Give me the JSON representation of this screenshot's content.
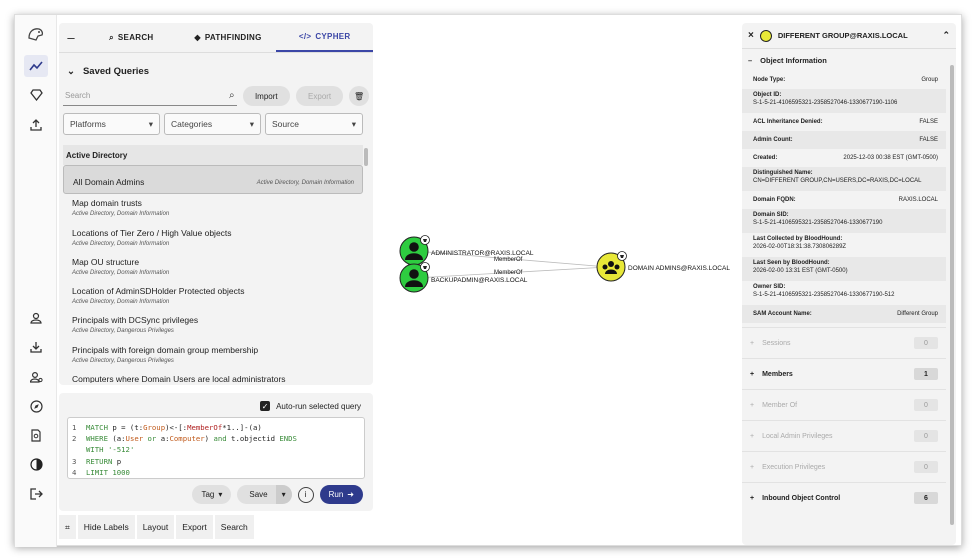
{
  "tabs": {
    "search": "SEARCH",
    "pathfinding": "PATHFINDING",
    "cypher": "CYPHER"
  },
  "saved_queries": {
    "title": "Saved Queries",
    "search_placeholder": "Search",
    "import_label": "Import",
    "export_label": "Export",
    "filters": [
      "Platforms",
      "Categories",
      "Source"
    ],
    "category": "Active Directory",
    "items": [
      {
        "title": "All Domain Admins",
        "sub": "Active Directory, Domain Information"
      },
      {
        "title": "Map domain trusts",
        "sub": "Active Directory, Domain Information"
      },
      {
        "title": "Locations of Tier Zero / High Value objects",
        "sub": "Active Directory, Domain Information"
      },
      {
        "title": "Map OU structure",
        "sub": "Active Directory, Domain Information"
      },
      {
        "title": "Location of AdminSDHolder Protected objects",
        "sub": "Active Directory, Domain Information"
      },
      {
        "title": "Principals with DCSync privileges",
        "sub": "Active Directory, Dangerous Privileges"
      },
      {
        "title": "Principals with foreign domain group membership",
        "sub": "Active Directory, Dangerous Privileges"
      },
      {
        "title": "Computers where Domain Users are local administrators",
        "sub": "Active Directory, Dangerous Privileges"
      }
    ]
  },
  "editor": {
    "autorun_label": "Auto-run selected query",
    "lines": [
      {
        "n": "1",
        "text": "MATCH p = (t:Group)<-[:MemberOf*1..]-(a)"
      },
      {
        "n": "2",
        "text": "WHERE (a:User or a:Computer) and t.objectid ENDS"
      },
      {
        "n": "",
        "text": "WITH '-512'"
      },
      {
        "n": "3",
        "text": "RETURN p"
      },
      {
        "n": "4",
        "text": "LIMIT 1000"
      }
    ],
    "tag_label": "Tag",
    "save_label": "Save",
    "info_label": "i",
    "run_label": "Run"
  },
  "bottom_bar": {
    "hide_labels": "Hide Labels",
    "layout": "Layout",
    "export": "Export",
    "search": "Search"
  },
  "graph": {
    "nodes": [
      {
        "label": "ADMINISTRATOR@RAXIS.LOCAL",
        "kind": "user",
        "color": "#2ecc40"
      },
      {
        "label": "BACKUPADMIN@RAXIS.LOCAL",
        "kind": "user",
        "color": "#2ecc40"
      },
      {
        "label": "DOMAIN ADMINS@RAXIS.LOCAL",
        "kind": "group",
        "color": "#e8e838"
      }
    ],
    "edges": [
      {
        "label": "MemberOf"
      },
      {
        "label": "MemberOf"
      }
    ]
  },
  "entity": {
    "title": "DIFFERENT GROUP@RAXIS.LOCAL",
    "section": "Object Information",
    "props": [
      {
        "label": "Node Type:",
        "value": "Group",
        "inline": true
      },
      {
        "label": "Object ID:",
        "value": "S-1-5-21-4106595321-2358527046-1330677190-1106",
        "inline": false
      },
      {
        "label": "ACL Inheritance Denied:",
        "value": "FALSE",
        "inline": true
      },
      {
        "label": "Admin Count:",
        "value": "FALSE",
        "inline": true
      },
      {
        "label": "Created:",
        "value": "2025-12-03 00:38 EST (GMT-0500)",
        "inline": true
      },
      {
        "label": "Distinguished Name:",
        "value": "CN=DIFFERENT GROUP,CN=USERS,DC=RAXIS,DC=LOCAL",
        "inline": false
      },
      {
        "label": "Domain FQDN:",
        "value": "RAXIS.LOCAL",
        "inline": true
      },
      {
        "label": "Domain SID:",
        "value": "S-1-5-21-4106595321-2358527046-1330677190",
        "inline": false
      },
      {
        "label": "Last Collected by BloodHound:",
        "value": "2026-02-00T18:31:38.730806289Z",
        "inline": false
      },
      {
        "label": "Last Seen by BloodHound:",
        "value": "2026-02-00 13:31 EST (GMT-0500)",
        "inline": false
      },
      {
        "label": "Owner SID:",
        "value": "S-1-5-21-4106595321-2358527046-1330677190-512",
        "inline": false
      },
      {
        "label": "SAM Account Name:",
        "value": "Different Group",
        "inline": true
      }
    ],
    "sections": [
      {
        "label": "Sessions",
        "count": "0",
        "active": false
      },
      {
        "label": "Members",
        "count": "1",
        "active": true
      },
      {
        "label": "Member Of",
        "count": "0",
        "active": false
      },
      {
        "label": "Local Admin Privileges",
        "count": "0",
        "active": false
      },
      {
        "label": "Execution Privileges",
        "count": "0",
        "active": false
      },
      {
        "label": "Inbound Object Control",
        "count": "6",
        "active": true
      }
    ]
  }
}
